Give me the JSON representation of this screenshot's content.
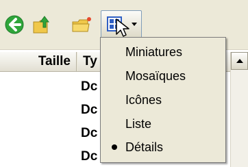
{
  "header": {
    "columns": [
      "Taille",
      "Ty"
    ]
  },
  "rows": [
    "Dc",
    "Dc",
    "Dc",
    "Dc"
  ],
  "views_menu": {
    "items": [
      {
        "label": "Miniatures",
        "selected": false
      },
      {
        "label": "Mosaïques",
        "selected": false
      },
      {
        "label": "Icônes",
        "selected": false
      },
      {
        "label": "Liste",
        "selected": false
      },
      {
        "label": "Détails",
        "selected": true
      }
    ]
  },
  "icons": {
    "back": "back-arrow-icon",
    "up": "folder-up-icon",
    "folders": "folders-icon",
    "views": "views-icon"
  },
  "colors": {
    "chrome": "#ece9d8",
    "back_green": "#2fa53a",
    "folder_yellow": "#f0c84a",
    "views_blue": "#2f5fc4"
  }
}
